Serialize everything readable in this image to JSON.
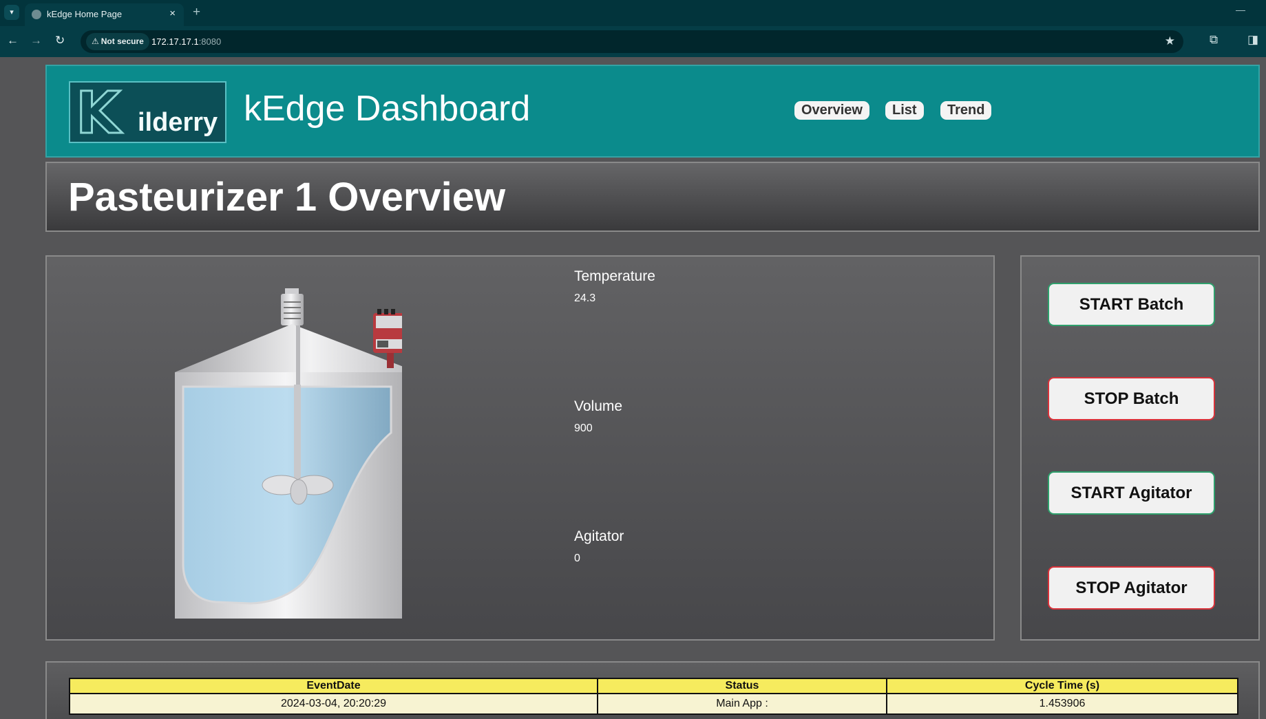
{
  "browser": {
    "tab_title": "kEdge Home Page",
    "new_tab_symbol": "+",
    "security_label": "Not secure",
    "url_host": "172.17.17.1",
    "url_port": ":8080"
  },
  "header": {
    "logo_letter": "K",
    "logo_word": "ilderry",
    "title": "kEdge Dashboard",
    "nav": [
      "Overview",
      "List",
      "Trend"
    ]
  },
  "page_title": "Pasteurizer 1 Overview",
  "metrics": [
    {
      "label": "Temperature",
      "value": "24.3"
    },
    {
      "label": "Volume",
      "value": "900"
    },
    {
      "label": "Agitator",
      "value": "0"
    }
  ],
  "controls": {
    "start_batch": "START Batch",
    "stop_batch": "STOP Batch",
    "start_agitator": "START Agitator",
    "stop_agitator": "STOP Agitator"
  },
  "table": {
    "headers": [
      "EventDate",
      "Status",
      "Cycle Time (s)"
    ],
    "rows": [
      [
        "2024-03-04, 20:20:29",
        "Main App :",
        "1.453906"
      ]
    ]
  },
  "colors": {
    "tab_bar": "#02343c",
    "toolbar": "#053d46",
    "header": "#0b8b8c",
    "start_border": "#2ea06c",
    "stop_border": "#d9323a",
    "table_header": "#f6eb5e"
  }
}
